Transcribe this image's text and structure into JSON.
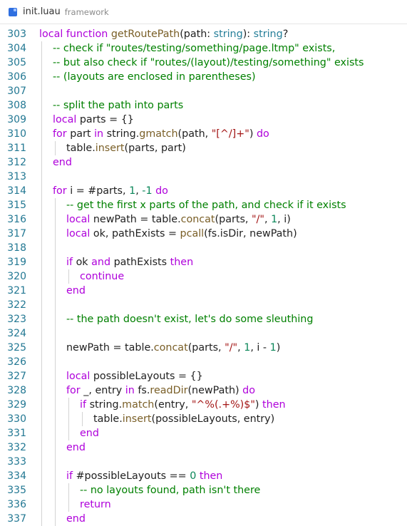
{
  "tab": {
    "filename": "init.luau",
    "folder": "framework"
  },
  "code_lines": [
    {
      "num": "303",
      "indent": 0,
      "tokens": [
        [
          "kw",
          "local "
        ],
        [
          "kw",
          "function "
        ],
        [
          "fn",
          "getRoutePath"
        ],
        [
          "p",
          "(path: "
        ],
        [
          "ty",
          "string"
        ],
        [
          "p",
          "): "
        ],
        [
          "ty",
          "string"
        ],
        [
          "p",
          "?"
        ]
      ]
    },
    {
      "num": "304",
      "indent": 1,
      "tokens": [
        [
          "cm",
          "-- check if \"routes/testing/something/page.ltmp\" exists,"
        ]
      ]
    },
    {
      "num": "305",
      "indent": 1,
      "tokens": [
        [
          "cm",
          "-- but also check if \"routes/(layout)/testing/something\" exists"
        ]
      ]
    },
    {
      "num": "306",
      "indent": 1,
      "tokens": [
        [
          "cm",
          "-- (layouts are enclosed in parentheses)"
        ]
      ]
    },
    {
      "num": "307",
      "indent": 1,
      "tokens": []
    },
    {
      "num": "308",
      "indent": 1,
      "tokens": [
        [
          "cm",
          "-- split the path into parts"
        ]
      ]
    },
    {
      "num": "309",
      "indent": 1,
      "tokens": [
        [
          "kw",
          "local "
        ],
        [
          "p",
          "parts = {}"
        ]
      ]
    },
    {
      "num": "310",
      "indent": 1,
      "tokens": [
        [
          "ctl",
          "for "
        ],
        [
          "p",
          "part "
        ],
        [
          "ctl",
          "in "
        ],
        [
          "p",
          "string."
        ],
        [
          "fn",
          "gmatch"
        ],
        [
          "p",
          "(path, "
        ],
        [
          "str",
          "\"[^/]+\""
        ],
        [
          "p",
          ") "
        ],
        [
          "ctl",
          "do"
        ]
      ]
    },
    {
      "num": "311",
      "indent": 2,
      "tokens": [
        [
          "p",
          "table."
        ],
        [
          "fn",
          "insert"
        ],
        [
          "p",
          "(parts, part)"
        ]
      ]
    },
    {
      "num": "312",
      "indent": 1,
      "tokens": [
        [
          "ctl",
          "end"
        ]
      ]
    },
    {
      "num": "313",
      "indent": 1,
      "tokens": []
    },
    {
      "num": "314",
      "indent": 1,
      "tokens": [
        [
          "ctl",
          "for "
        ],
        [
          "p",
          "i = #parts, "
        ],
        [
          "num",
          "1"
        ],
        [
          "p",
          ", "
        ],
        [
          "num",
          "-1 "
        ],
        [
          "ctl",
          "do"
        ]
      ]
    },
    {
      "num": "315",
      "indent": 2,
      "tokens": [
        [
          "cm",
          "-- get the first x parts of the path, and check if it exists"
        ]
      ]
    },
    {
      "num": "316",
      "indent": 2,
      "tokens": [
        [
          "kw",
          "local "
        ],
        [
          "p",
          "newPath = table."
        ],
        [
          "fn",
          "concat"
        ],
        [
          "p",
          "(parts, "
        ],
        [
          "str",
          "\"/\""
        ],
        [
          "p",
          ", "
        ],
        [
          "num",
          "1"
        ],
        [
          "p",
          ", i)"
        ]
      ]
    },
    {
      "num": "317",
      "indent": 2,
      "tokens": [
        [
          "kw",
          "local "
        ],
        [
          "p",
          "ok, pathExists = "
        ],
        [
          "fn",
          "pcall"
        ],
        [
          "p",
          "(fs.isDir, newPath)"
        ]
      ]
    },
    {
      "num": "318",
      "indent": 2,
      "tokens": []
    },
    {
      "num": "319",
      "indent": 2,
      "tokens": [
        [
          "ctl",
          "if "
        ],
        [
          "p",
          "ok "
        ],
        [
          "kw",
          "and "
        ],
        [
          "p",
          "pathExists "
        ],
        [
          "ctl",
          "then"
        ]
      ]
    },
    {
      "num": "320",
      "indent": 3,
      "tokens": [
        [
          "ctl",
          "continue"
        ]
      ]
    },
    {
      "num": "321",
      "indent": 2,
      "tokens": [
        [
          "ctl",
          "end"
        ]
      ]
    },
    {
      "num": "322",
      "indent": 2,
      "tokens": []
    },
    {
      "num": "323",
      "indent": 2,
      "tokens": [
        [
          "cm",
          "-- the path doesn't exist, let's do some sleuthing"
        ]
      ]
    },
    {
      "num": "324",
      "indent": 2,
      "tokens": []
    },
    {
      "num": "325",
      "indent": 2,
      "tokens": [
        [
          "p",
          "newPath = table."
        ],
        [
          "fn",
          "concat"
        ],
        [
          "p",
          "(parts, "
        ],
        [
          "str",
          "\"/\""
        ],
        [
          "p",
          ", "
        ],
        [
          "num",
          "1"
        ],
        [
          "p",
          ", i - "
        ],
        [
          "num",
          "1"
        ],
        [
          "p",
          ")"
        ]
      ]
    },
    {
      "num": "326",
      "indent": 2,
      "tokens": []
    },
    {
      "num": "327",
      "indent": 2,
      "tokens": [
        [
          "kw",
          "local "
        ],
        [
          "p",
          "possibleLayouts = {}"
        ]
      ]
    },
    {
      "num": "328",
      "indent": 2,
      "tokens": [
        [
          "ctl",
          "for "
        ],
        [
          "p",
          "_, entry "
        ],
        [
          "ctl",
          "in "
        ],
        [
          "p",
          "fs."
        ],
        [
          "fn",
          "readDir"
        ],
        [
          "p",
          "(newPath) "
        ],
        [
          "ctl",
          "do"
        ]
      ]
    },
    {
      "num": "329",
      "indent": 3,
      "tokens": [
        [
          "ctl",
          "if "
        ],
        [
          "p",
          "string."
        ],
        [
          "fn",
          "match"
        ],
        [
          "p",
          "(entry, "
        ],
        [
          "str",
          "\"^%(.+%)$\""
        ],
        [
          "p",
          ") "
        ],
        [
          "ctl",
          "then"
        ]
      ]
    },
    {
      "num": "330",
      "indent": 4,
      "tokens": [
        [
          "p",
          "table."
        ],
        [
          "fn",
          "insert"
        ],
        [
          "p",
          "(possibleLayouts, entry)"
        ]
      ]
    },
    {
      "num": "331",
      "indent": 3,
      "tokens": [
        [
          "ctl",
          "end"
        ]
      ]
    },
    {
      "num": "332",
      "indent": 2,
      "tokens": [
        [
          "ctl",
          "end"
        ]
      ]
    },
    {
      "num": "333",
      "indent": 2,
      "tokens": []
    },
    {
      "num": "334",
      "indent": 2,
      "tokens": [
        [
          "ctl",
          "if "
        ],
        [
          "p",
          "#possibleLayouts == "
        ],
        [
          "num",
          "0 "
        ],
        [
          "ctl",
          "then"
        ]
      ]
    },
    {
      "num": "335",
      "indent": 3,
      "tokens": [
        [
          "cm",
          "-- no layouts found, path isn't there"
        ]
      ]
    },
    {
      "num": "336",
      "indent": 3,
      "tokens": [
        [
          "ctl",
          "return"
        ]
      ]
    },
    {
      "num": "337",
      "indent": 2,
      "tokens": [
        [
          "ctl",
          "end"
        ]
      ]
    }
  ]
}
